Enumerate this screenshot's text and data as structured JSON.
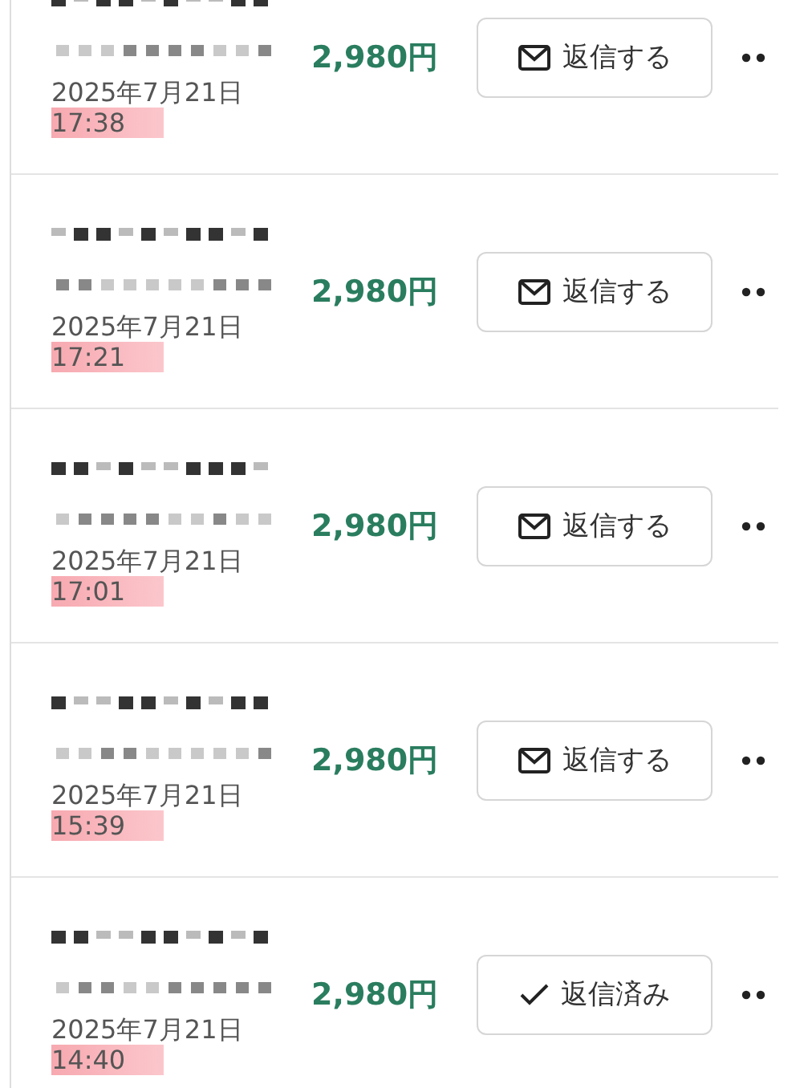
{
  "orders": [
    {
      "date": "2025年7月21日",
      "time": "17:38",
      "time_highlighted": true,
      "price": "2,980円",
      "reply": {
        "kind": "reply",
        "label": "返信する"
      }
    },
    {
      "date": "2025年7月21日",
      "time": "17:21",
      "time_highlighted": true,
      "price": "2,980円",
      "reply": {
        "kind": "reply",
        "label": "返信する"
      }
    },
    {
      "date": "2025年7月21日",
      "time": "17:01",
      "time_highlighted": true,
      "price": "2,980円",
      "reply": {
        "kind": "reply",
        "label": "返信する"
      }
    },
    {
      "date": "2025年7月21日",
      "time": "15:39",
      "time_highlighted": true,
      "price": "2,980円",
      "reply": {
        "kind": "reply",
        "label": "返信する"
      }
    },
    {
      "date": "2025年7月21日",
      "time": "14:40",
      "time_highlighted": true,
      "price": "2,980円",
      "reply": {
        "kind": "replied",
        "label": "返信済み"
      }
    }
  ]
}
